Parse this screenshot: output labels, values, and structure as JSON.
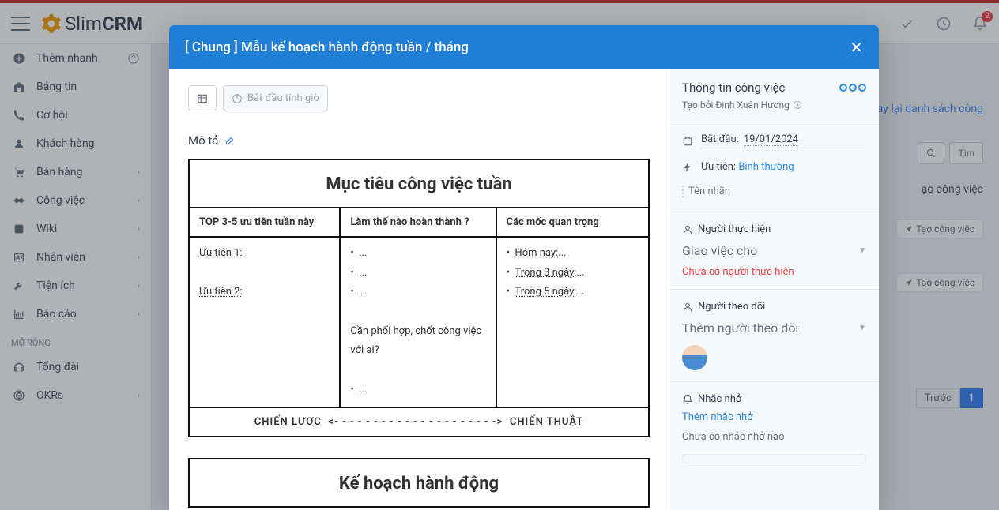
{
  "brand": {
    "slim": "Slim",
    "crm": "CRM"
  },
  "notifications": {
    "bell_count": "2"
  },
  "sidebar": {
    "quick_add": "Thêm nhanh",
    "items": [
      {
        "label": "Bảng tin"
      },
      {
        "label": "Cơ hội"
      },
      {
        "label": "Khách hàng"
      },
      {
        "label": "Bán hàng"
      },
      {
        "label": "Công việc"
      },
      {
        "label": "Wiki"
      },
      {
        "label": "Nhân viên"
      },
      {
        "label": "Tiện ích"
      },
      {
        "label": "Báo cáo"
      }
    ],
    "group_label": "MỞ RỘNG",
    "ext": [
      {
        "label": "Tổng đài"
      },
      {
        "label": "OKRs"
      }
    ]
  },
  "bg": {
    "back_text": "ay lại danh sách công",
    "search_placeholder": "Tìm",
    "breadcrumb_tail": "ạo công việc",
    "create_task": "Tạo công việc",
    "prev": "Trước",
    "page": "1"
  },
  "modal": {
    "title": "[ Chung ] Mẫu kế hoạch hành động tuần / tháng",
    "timer_btn": "Bắt đầu tính giờ",
    "desc_label": "Mô tả",
    "doc": {
      "title1": "Mục tiêu công việc tuần",
      "hcol1": "TOP 3-5 ưu tiên tuần này",
      "hcol2": "Làm thế nào hoàn thành ?",
      "hcol3": "Các mốc quan trọng",
      "p1": "Ưu tiên 1:",
      "p2": "Ưu tiên 2:",
      "b1": "...",
      "b2": "...",
      "b3": "...",
      "coord": "Cần phối hợp, chốt công việc với ai?",
      "m_today": "Hôm nay:",
      "m_today_t": "...",
      "m_3d": "Trong 3 ngày:",
      "m_3d_t": "...",
      "m_5d": "Trong 5 ngày:",
      "m_5d_t": "...",
      "strat": "CHIẾN LƯỢC",
      "tact": "CHIẾN THUẬT",
      "dashes": "<- - - - - - - - - - - - - - - - - - - - ->",
      "title2": "Kế hoạch hành động"
    },
    "right": {
      "info_title": "Thông tin công việc",
      "created_by": "Tạo bởi Đinh Xuân Hương",
      "start_label": "Bắt đầu:",
      "start_date": "19/01/2024",
      "priority_label": "Ưu tiên:",
      "priority_value": "Bình thường",
      "label_placeholder": "Tên nhãn",
      "assignee_title": "Người thực hiện",
      "assign_placeholder": "Giao việc cho",
      "no_assignee": "Chưa có người thực hiện",
      "follower_title": "Người theo dõi",
      "add_follower": "Thêm người theo dõi",
      "reminder_title": "Nhắc nhở",
      "add_reminder": "Thêm nhắc nhở",
      "no_reminder": "Chưa có nhắc nhở nào"
    }
  }
}
